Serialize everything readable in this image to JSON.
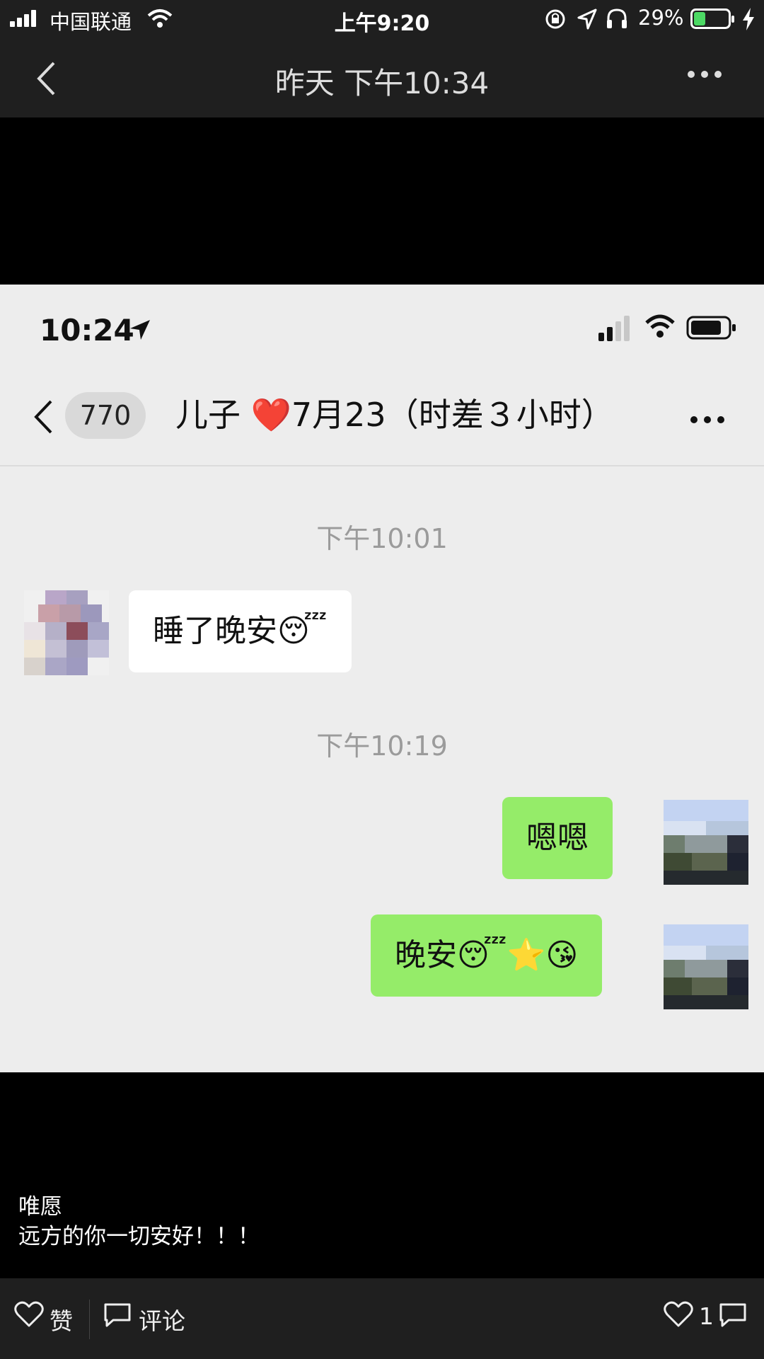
{
  "outer_status": {
    "carrier": "中国联通",
    "time": "上午9:20",
    "battery": "29%"
  },
  "outer_nav": {
    "title": "昨天 下午10:34"
  },
  "inner_screenshot": {
    "status_time": "10:24",
    "unread_count": "770",
    "chat_title": "儿子 ❤️7月23（时差３小时）",
    "timestamp_1": "下午10:01",
    "msg_1": "睡了晚安😴",
    "timestamp_2": "下午10:19",
    "msg_2": "嗯嗯",
    "msg_3": "晚安😴⭐😘"
  },
  "caption": {
    "line1": "唯愿",
    "line2": "远方的你一切安好！！！"
  },
  "bottom_bar": {
    "like_label": "赞",
    "comment_label": "评论",
    "like_count": "1"
  },
  "colors": {
    "bar_bg": "#1f1f1f",
    "chat_bg": "#ededed",
    "bubble_self": "#95ec69",
    "bubble_other": "#ffffff",
    "battery_green": "#4cd964"
  }
}
